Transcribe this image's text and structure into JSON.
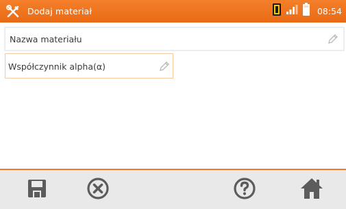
{
  "header": {
    "title": "Dodaj materiał",
    "time": "08:54",
    "app_icon": "tools-icon",
    "status_icons": [
      "sd-card-icon",
      "signal-icon",
      "battery-icon"
    ]
  },
  "form": {
    "material_name_placeholder": "Nazwa materiału",
    "alpha_placeholder": "Współczynnik alpha(α)",
    "edit_icon": "pencil-icon"
  },
  "toolbar": {
    "buttons": [
      "save-icon",
      "cancel-icon",
      "help-icon",
      "home-icon"
    ]
  },
  "colors": {
    "accent": "#ee7420",
    "toolbar_bg": "#e9e9e9",
    "icon_gray": "#5c5c5c"
  }
}
